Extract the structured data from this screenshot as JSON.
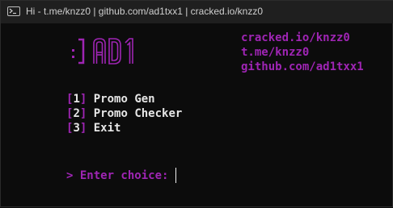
{
  "window": {
    "title": "Hi - t.me/knzz0 | github.com/ad1txx1 | cracked.io/knzz0",
    "icon": "terminal-icon"
  },
  "logo": {
    "text": ":] AD1",
    "color": "#9f25b4"
  },
  "links": [
    "cracked.io/knzz0",
    "t.me/knzz0",
    "github.com/ad1txx1"
  ],
  "menu": {
    "items": [
      {
        "open": "[",
        "number": "1",
        "close": "]",
        "label": " Promo Gen"
      },
      {
        "open": "[",
        "number": "2",
        "close": "]",
        "label": " Promo Checker"
      },
      {
        "open": "[",
        "number": "3",
        "close": "]",
        "label": " Exit"
      }
    ]
  },
  "prompt": {
    "text": "> Enter choice:"
  },
  "colors": {
    "accent": "#9f25b4",
    "text": "#e6e6e6",
    "background": "#0c0c0c"
  }
}
